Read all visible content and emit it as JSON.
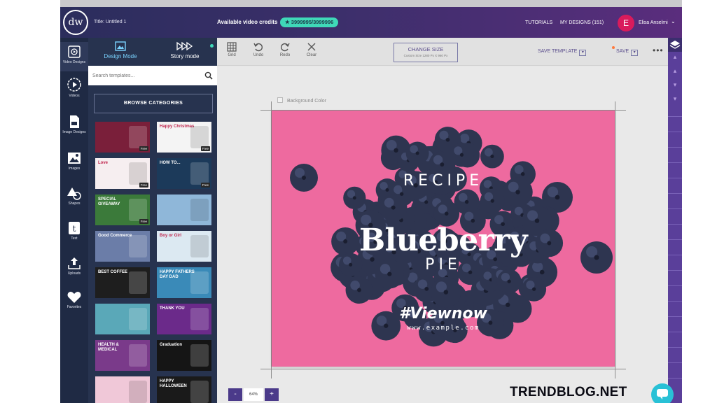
{
  "topbar": {
    "logo": "dw",
    "doc_title": "Title: Untitled 1",
    "credits_label": "Available video credits",
    "credits_value": "★ 3999995/3999996",
    "tutorials": "TUTORIALS",
    "my_designs": "MY DESIGNS (151)",
    "avatar_letter": "E",
    "user_name": "Elisa Anselmi",
    "user_caret": "⌄"
  },
  "rail": {
    "items": [
      {
        "label": "Video Designs",
        "icon": "video-designs-icon"
      },
      {
        "label": "Videos",
        "icon": "video-play-icon"
      },
      {
        "label": "Image Designs",
        "icon": "image-designs-icon"
      },
      {
        "label": "Images",
        "icon": "image-icon"
      },
      {
        "label": "Shapes",
        "icon": "shapes-icon"
      },
      {
        "label": "Text",
        "icon": "text-icon"
      },
      {
        "label": "Uploads",
        "icon": "upload-icon"
      },
      {
        "label": "Favorites",
        "icon": "heart-icon"
      }
    ]
  },
  "panel": {
    "design_mode": "Design Mode",
    "story_mode": "Story mode",
    "search_placeholder": "Search templates...",
    "browse": "BROWSE CATEGORIES",
    "free_label": "Free",
    "thumbs": [
      {
        "text": "",
        "bg": "#7a1f3a"
      },
      {
        "text": "Happy Christmas",
        "bg": "#f4f4f4"
      },
      {
        "text": "Love",
        "bg": "#f6eef0"
      },
      {
        "text": "HOW TO...",
        "bg": "#1c3a5a"
      },
      {
        "text": "SPECIAL GIVEAWAY",
        "bg": "#3b7a3a"
      },
      {
        "text": "",
        "bg": "#8fb7d9"
      },
      {
        "text": "Good Commerce",
        "bg": "#6b7da8"
      },
      {
        "text": "Boy or Girl",
        "bg": "#dce9f2"
      },
      {
        "text": "BEST COFFEE",
        "bg": "#1e1e1e"
      },
      {
        "text": "HAPPY FATHERS DAY DAD",
        "bg": "#3a8ab8"
      },
      {
        "text": "",
        "bg": "#5aa8b8"
      },
      {
        "text": "THANK YOU",
        "bg": "#6b2a8a"
      },
      {
        "text": "HEALTH & MEDICAL",
        "bg": "#7a3a8a"
      },
      {
        "text": "Graduation",
        "bg": "#151515"
      },
      {
        "text": "",
        "bg": "#f0c8d8"
      },
      {
        "text": "HAPPY HALLOWEEN",
        "bg": "#1a1a1a"
      }
    ]
  },
  "toolbar": {
    "grid": "Grid",
    "undo": "Undo",
    "redo": "Redo",
    "clear": "Clear",
    "change_size": "CHANGE SIZE",
    "change_size_sub": "Custom Size 1280 Px X 960 Px",
    "save_template": "SAVE TEMPLATE",
    "save": "SAVE",
    "more": "•••"
  },
  "layers": {
    "glyphs": [
      "▴",
      "▴",
      "▾",
      "▾"
    ]
  },
  "canvas": {
    "background_color_label": "Background Color",
    "zoom_minus": "-",
    "zoom_value": "64%",
    "zoom_plus": "+"
  },
  "design": {
    "recipe": "RECIPE",
    "title": "Blueberry",
    "pie": "PIE",
    "hashtag": "#Viewnow",
    "url": "www.example.com",
    "background": "#ee6a9f",
    "berry_color": "#2e3550"
  },
  "watermark": "TRENDBLOG.NET",
  "colors": {
    "topbar": "#3c2f6b",
    "rail": "#1f2a44",
    "accent_teal": "#3fd9b8",
    "accent_purple": "#5a3f9a",
    "avatar": "#d91b5c"
  }
}
